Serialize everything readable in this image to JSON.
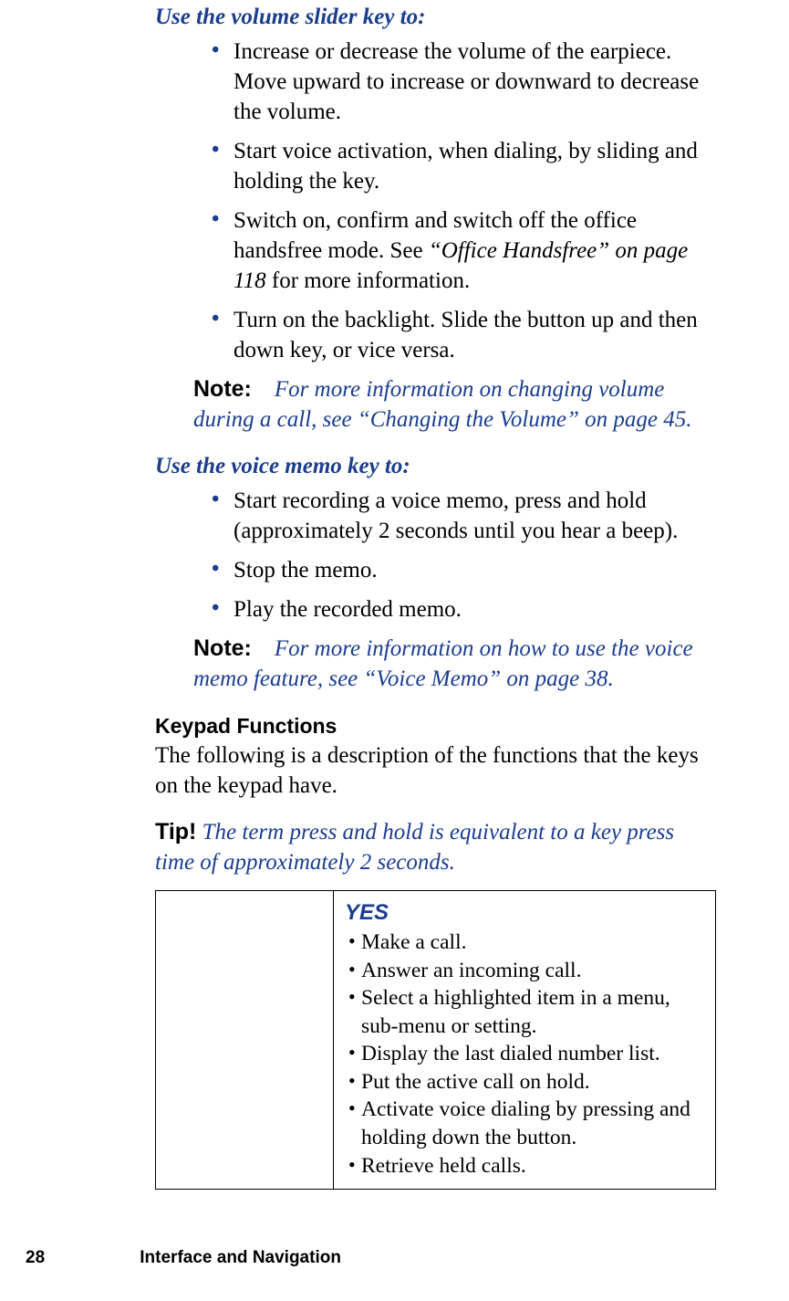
{
  "section1": {
    "heading": "Use the volume slider key to:",
    "bullets": [
      {
        "text": "Increase or decrease the volume of the earpiece. Move upward to increase or downward to decrease the volume."
      },
      {
        "text": "Start voice activation, when dialing, by sliding and holding the key."
      },
      {
        "pre": "Switch on, confirm and switch off the office handsfree mode. See ",
        "ref": "“Office Handsfree” on page 118",
        "post": " for more information."
      },
      {
        "text": "Turn on the backlight. Slide the button up and then down key, or vice versa."
      }
    ],
    "note": {
      "label": "Note:",
      "text": "For more information on changing volume during a call, see “Changing the Volume” on page 45."
    }
  },
  "section2": {
    "heading": "Use the voice memo key to:",
    "bullets": [
      {
        "text": "Start recording a voice memo, press and hold (approximately 2 seconds until you hear a beep)."
      },
      {
        "text": "Stop the memo."
      },
      {
        "text": "Play the recorded memo."
      }
    ],
    "note": {
      "label": "Note:",
      "text": "For more information on how to use the voice memo feature, see “Voice Memo” on page 38."
    }
  },
  "keypad": {
    "heading": "Keypad Functions",
    "intro": "The following is a description of the functions that the keys on the keypad have.",
    "tip": {
      "label": "Tip!",
      "text": "The term press and hold is equivalent to a key press time of approximately 2 seconds."
    },
    "table": {
      "key_name": "YES",
      "items": [
        "Make a call.",
        "Answer an incoming call.",
        "Select a highlighted item in a menu, sub-menu or setting.",
        "Display the last dialed number list.",
        "Put the active call on hold.",
        "Activate voice dialing by pressing and holding down the button.",
        "Retrieve held calls."
      ]
    }
  },
  "footer": {
    "page": "28",
    "title": "Interface and Navigation"
  }
}
